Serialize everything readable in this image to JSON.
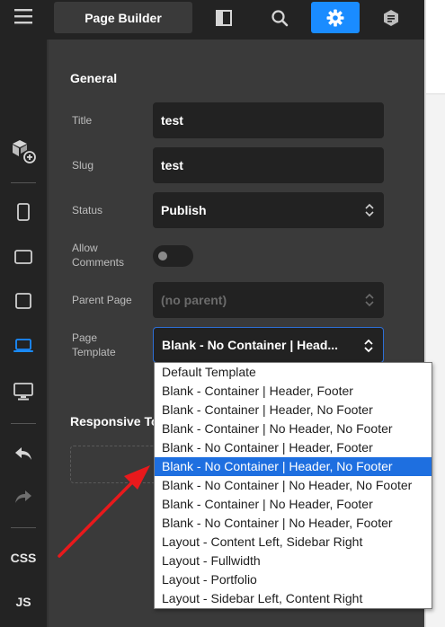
{
  "sidebar": {
    "css_label": "CSS",
    "js_label": "JS"
  },
  "topbar": {
    "title": "Page Builder"
  },
  "general": {
    "heading": "General",
    "title_label": "Title",
    "title_value": "test",
    "slug_label": "Slug",
    "slug_value": "test",
    "status_label": "Status",
    "status_value": "Publish",
    "comments_label_1": "Allow",
    "comments_label_2": "Comments",
    "parent_label": "Parent Page",
    "parent_value": "(no parent)",
    "template_label_1": "Page",
    "template_label_2": "Template",
    "template_value": "Blank - No Container | Head..."
  },
  "responsive": {
    "heading": "Responsive To"
  },
  "dropdown": {
    "options": [
      "Default Template",
      "Blank - Container | Header, Footer",
      "Blank - Container | Header, No Footer",
      "Blank - Container | No Header, No Footer",
      "Blank - No Container | Header, Footer",
      "Blank - No Container | Header, No Footer",
      "Blank - No Container | No Header, No Footer",
      "Blank - Container | No Header, Footer",
      "Blank - No Container | No Header, Footer",
      "Layout - Content Left, Sidebar Right",
      "Layout - Fullwidth",
      "Layout - Portfolio",
      "Layout - Sidebar Left, Content Right"
    ],
    "selected_index": 5
  },
  "colors": {
    "accent": "#1a8cff",
    "selected_option": "#1e6fe0",
    "annotation_arrow": "#e8191c"
  }
}
